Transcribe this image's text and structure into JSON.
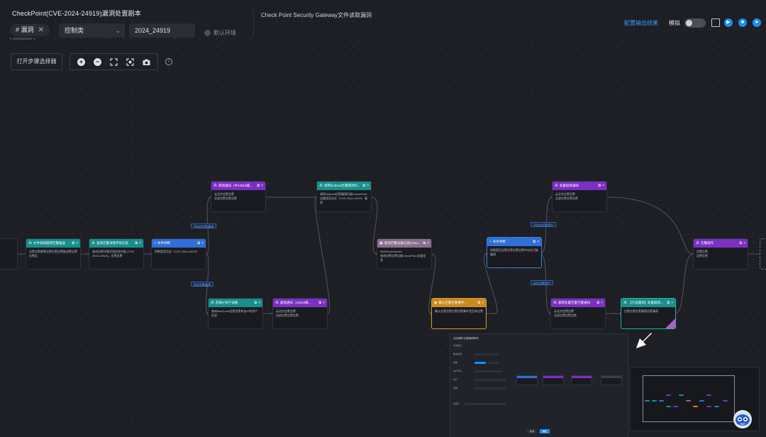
{
  "header": {
    "title": "CheckPoint(CVE-2024-24919)漏洞处置剧本",
    "tag": "# 漏洞",
    "tag_close": "✕",
    "category": "控制类",
    "code": "2024_24919",
    "env_label": "默认环境",
    "subtitle": "Check  Point Security Gateway文件读取漏洞",
    "config_link": "配置输出结果",
    "sim_label": "模拟",
    "sim_on": false
  },
  "toolbar": {
    "open_selector": "打开步骤选择器",
    "tools": [
      "zoom-in-icon",
      "zoom-out-icon",
      "fit-view-icon",
      "focus-icon",
      "camera-icon"
    ],
    "info": "i"
  },
  "colors": {
    "teal": "#178f8c",
    "purple": "#7b2fc3",
    "blue": "#2f6fd8",
    "mauve": "#8b6d8f",
    "orange": "#cb8a1f",
    "accent": "#1c8cf2",
    "edge": "#4f5561",
    "edge_label": "#6fa8ff"
  },
  "nodes": [
    {
      "id": "n1",
      "title": "文件调阅漏洞告警推送",
      "body": "告警告警推警告警告警告警推送警告警告警告",
      "color": "teal"
    },
    {
      "id": "n2",
      "title": "查询告警详情字段信息",
      "body": "查询告警详情字段信息内容 (CVE-2024-24919)，告警告警",
      "color": "teal"
    },
    {
      "id": "n3",
      "title": "条件判断",
      "body": "判断是否包含（CVE-2024-24919）",
      "color": "blue"
    },
    {
      "id": "n4",
      "title": "漏洞通知（中24919漏...",
      "body": "云北京告警告警\n总部告警告警告警",
      "color": "purple"
    },
    {
      "id": "n5",
      "title": "获取IP资产详情",
      "body": "查询NetGuard告警告警来自IP的资产信息",
      "color": "teal"
    },
    {
      "id": "n6",
      "title": "漏洞通知（24919漏...",
      "body": "云北京告警告警\n总部告警告警告警",
      "color": "purple"
    },
    {
      "id": "n7",
      "title": "调用Nuthunt告警漏洞扫...",
      "body": "调用Nuthunt告警漏洞扫描CheckPoint设备是否存在（CVE-2024-24919）漏洞",
      "color": "teal"
    },
    {
      "id": "n8",
      "title": "查询告警设备信息(Chec...",
      "body": "WebSockHandler\n查询告警告警设备CheckPoint设备信息",
      "color": "mauve"
    },
    {
      "id": "n9",
      "title": "确认告警告警事件...",
      "body": "确认告警告警告警告警事件是否有告警",
      "color": "orange"
    },
    {
      "id": "n10",
      "title": "条件判断",
      "body": "判断是否告警告警告警告警中存在可能漏洞",
      "color": "blue"
    },
    {
      "id": "n11",
      "title": "处置结果通知",
      "body": "云北京告警告警\n总部告警告警告警",
      "color": "purple"
    },
    {
      "id": "n12",
      "title": "漏洞处置告警告警通知",
      "body": "云北京告警告警\n总部告警告警告警",
      "color": "purple"
    },
    {
      "id": "n13",
      "title": "【只读漏洞】处置漏洞...",
      "body": "告警告警告警漏洞告警漏洞",
      "color": "teal"
    },
    {
      "id": "n14",
      "title": "告警操作",
      "body": "告警告警\n告警告警",
      "color": "purple"
    }
  ],
  "edge_labels": [
    {
      "text": "不存在告警漏洞"
    },
    {
      "text": "存在告警漏洞"
    },
    {
      "text": "不存在告警资产"
    },
    {
      "text": "存在告警资产"
    }
  ],
  "preview": {
    "title": "关闭漏洞 处置漏洞脚本",
    "labels": [
      "基本信息",
      "剧本名称",
      "类型",
      "执行环境",
      "执行",
      "说明",
      "检测人"
    ],
    "buttons": [
      "取消",
      "确定"
    ]
  },
  "minimap": {
    "label": "minimap"
  }
}
